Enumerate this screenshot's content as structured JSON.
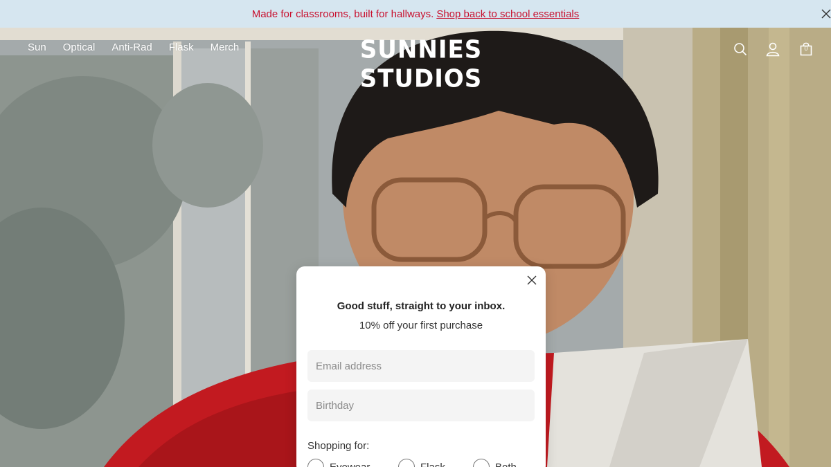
{
  "announcement": {
    "message": "Made for classrooms, built for hallways.",
    "link_text": "Shop back to school essentials"
  },
  "header": {
    "nav": [
      "Sun",
      "Optical",
      "Anti-Rad",
      "Flask",
      "Merch"
    ],
    "logo": "SUNNIES STUDIOS",
    "cart_count": "0",
    "icons": [
      "search-icon",
      "account-icon",
      "cart-icon"
    ]
  },
  "popup": {
    "title": "Good stuff, straight to your inbox.",
    "subtitle": "10% off your first purchase",
    "email_placeholder": "Email address",
    "birthday_placeholder": "Birthday",
    "shopping_label": "Shopping for:",
    "options": [
      "Eyewear",
      "Flask",
      "Both"
    ]
  },
  "colors": {
    "announcement_bg": "#d6e6f0",
    "announcement_text": "#c8102e",
    "popup_bg": "#ffffff",
    "input_bg": "#f4f4f4"
  }
}
